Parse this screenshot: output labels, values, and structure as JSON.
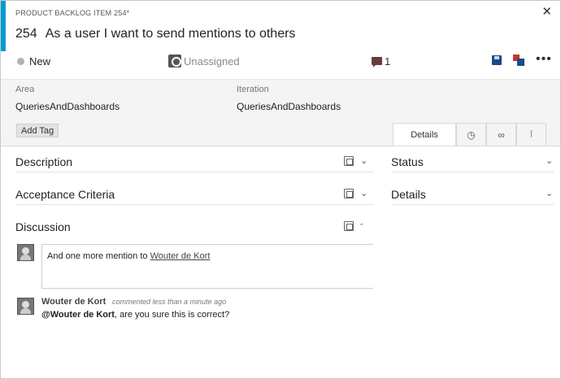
{
  "header": {
    "work_item_type": "PRODUCT BACKLOG ITEM 254*",
    "id": "254",
    "title": "As a user I want to send mentions to others",
    "close_icon": "close-icon",
    "accent_color": "#009ccc"
  },
  "status_bar": {
    "state": "New",
    "assigned_to": "Unassigned",
    "comment_count": "1",
    "icons": [
      "state-dot-icon",
      "user-icon",
      "comment-icon",
      "save-icon",
      "save-and-close-icon",
      "more-icon"
    ]
  },
  "fields": {
    "area_label": "Area",
    "area_value": "QueriesAndDashboards",
    "iteration_label": "Iteration",
    "iteration_value": "QueriesAndDashboards",
    "add_tag_label": "Add Tag"
  },
  "tabs": {
    "details_label": "Details",
    "icon_tabs": [
      "history-icon",
      "links-icon",
      "attachments-icon"
    ]
  },
  "sections": {
    "description": "Description",
    "acceptance_criteria": "Acceptance Criteria",
    "discussion": "Discussion",
    "status": "Status",
    "details": "Details"
  },
  "discussion": {
    "draft_text": "And one more mention to",
    "draft_mention": "Wouter de Kort",
    "comments": [
      {
        "author": "Wouter de Kort",
        "meta": "commented less than a minute ago",
        "mention": "@Wouter de Kort",
        "text": ", are you sure this is correct?"
      }
    ]
  }
}
